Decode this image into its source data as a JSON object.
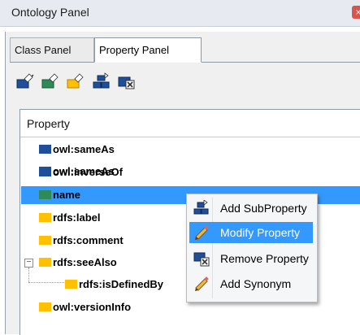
{
  "window": {
    "title": "Ontology Panel",
    "close_glyph": "×"
  },
  "tabs": [
    {
      "label": "Class Panel",
      "active": false
    },
    {
      "label": "Property Panel",
      "active": true
    }
  ],
  "toolbar": {
    "buttons": [
      {
        "icon": "add-property-icon"
      },
      {
        "icon": "add-object-property-icon"
      },
      {
        "icon": "add-datatype-property-icon"
      },
      {
        "icon": "add-subproperty-icon"
      },
      {
        "icon": "remove-property-icon"
      }
    ]
  },
  "tree": {
    "column_header": "Property",
    "rows": [
      {
        "label": "owl:sameAs",
        "color": "#1f4e9a"
      },
      {
        "label": "owl:inverseOf",
        "color": "#1f4e9a"
      },
      {
        "label": "name",
        "color": "#2e8b57",
        "selected": true
      },
      {
        "label": "rdfs:label",
        "color": "#ffc000"
      },
      {
        "label": "rdfs:comment",
        "color": "#ffc000"
      },
      {
        "label": "rdfs:seeAlso",
        "color": "#ffc000",
        "expanded": true
      },
      {
        "label": "rdfs:isDefinedBy",
        "color": "#ffc000",
        "child": true
      },
      {
        "label": "owl:versionInfo",
        "color": "#ffc000"
      }
    ],
    "expander_glyph": "−"
  },
  "context_menu": {
    "items": [
      {
        "label": "Add SubProperty",
        "icon": "add-subproperty-icon"
      },
      {
        "label": "Modify Property",
        "icon": "pencil-icon",
        "highlighted": true
      },
      {
        "label": "Remove Property",
        "icon": "remove-property-icon"
      },
      {
        "label": "Add Synonym",
        "icon": "pencil-icon"
      }
    ]
  },
  "colors": {
    "selection": "#3399ff",
    "object_property": "#1f4e9a",
    "datatype_property": "#2e8b57",
    "annotation_property": "#ffc000"
  }
}
